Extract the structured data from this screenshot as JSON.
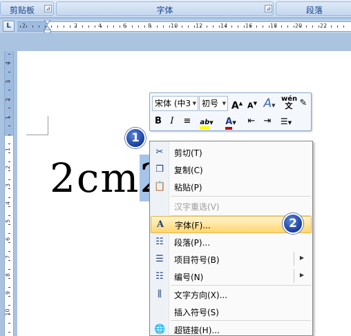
{
  "ribbon": {
    "groups": [
      {
        "label": "剪贴板",
        "launcher": "⊿"
      },
      {
        "label": "字体",
        "launcher": "⊿"
      },
      {
        "label": "段落"
      }
    ]
  },
  "ruler": {
    "corner_label": "L",
    "h_numbers": [
      "2",
      "2",
      "4",
      "6",
      "8",
      "10",
      "12",
      "14",
      "16",
      "18",
      "20",
      "22"
    ],
    "v_numbers": [
      "4",
      "3",
      "2",
      "1",
      "1",
      "2",
      "3",
      "4",
      "5",
      "6",
      "7",
      "8",
      "9",
      "10"
    ]
  },
  "document": {
    "text_plain": "2cm",
    "text_selected": "2"
  },
  "mini_toolbar": {
    "font_name": "宋体 (中3",
    "font_size": "初号",
    "grow_font": "A",
    "shrink_font": "A",
    "styles": "A",
    "phonetic": "wén",
    "bold": "B",
    "italic": "I",
    "font_color_letter": "A",
    "highlight_letter": "ab",
    "colors": {
      "font_color": "#c00000",
      "highlight": "#ffff00"
    }
  },
  "context_menu": {
    "items": [
      {
        "label": "剪切(T)",
        "icon": "scissors-icon"
      },
      {
        "label": "复制(C)",
        "icon": "copy-icon"
      },
      {
        "label": "粘贴(P)",
        "icon": "paste-icon"
      },
      {
        "label": "汉字重选(V)",
        "disabled": true
      },
      {
        "label": "字体(F)...",
        "icon": "font-icon",
        "highlighted": true
      },
      {
        "label": "段落(P)...",
        "icon": "paragraph-icon"
      },
      {
        "label": "项目符号(B)",
        "icon": "bullets-icon",
        "submenu": true
      },
      {
        "label": "编号(N)",
        "icon": "numbering-icon",
        "submenu": true
      },
      {
        "label": "文字方向(X)...",
        "icon": "text-direction-icon"
      },
      {
        "label": "插入符号(S)"
      },
      {
        "label": "超链接(H)...",
        "icon": "hyperlink-icon"
      }
    ]
  },
  "callouts": [
    "1",
    "2"
  ]
}
